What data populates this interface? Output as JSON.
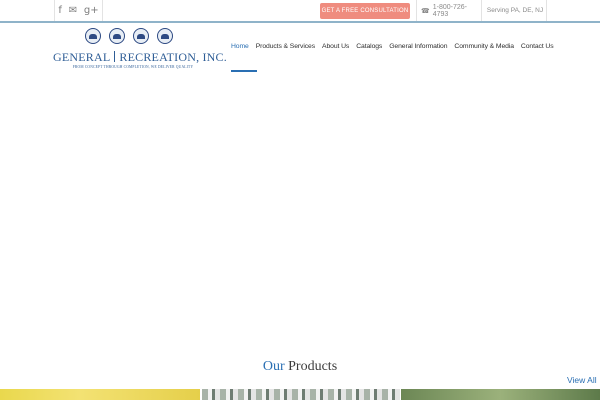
{
  "topbar": {
    "social": [
      {
        "icon": "facebook-icon",
        "glyph": "f"
      },
      {
        "icon": "twitter-icon",
        "glyph": "🐦"
      },
      {
        "icon": "google-plus-icon",
        "glyph": "g+"
      }
    ],
    "consult_label": "GET A FREE CONSULTATION",
    "phone_icon": "phone-icon",
    "phone": "1-800-726-4793",
    "serving": "Serving PA, DE, NJ"
  },
  "logo": {
    "name_left": "GENERAL",
    "name_right": "RECREATION, INC.",
    "tagline": "FROM CONCEPT THROUGH COMPLETION, WE DELIVER QUALITY"
  },
  "nav": {
    "items": [
      "Home",
      "Products & Services",
      "About Us",
      "Catalogs",
      "General Information",
      "Community & Media",
      "Contact Us"
    ],
    "active_index": 0
  },
  "products": {
    "title_highlight": "Our",
    "title_rest": " Products",
    "view_all": "View All"
  },
  "colors": {
    "accent": "#2a6fb3",
    "consult_bg": "#ef8c7f",
    "brand_navy": "#2e5d96",
    "topbar_border": "#8fb3c9"
  }
}
